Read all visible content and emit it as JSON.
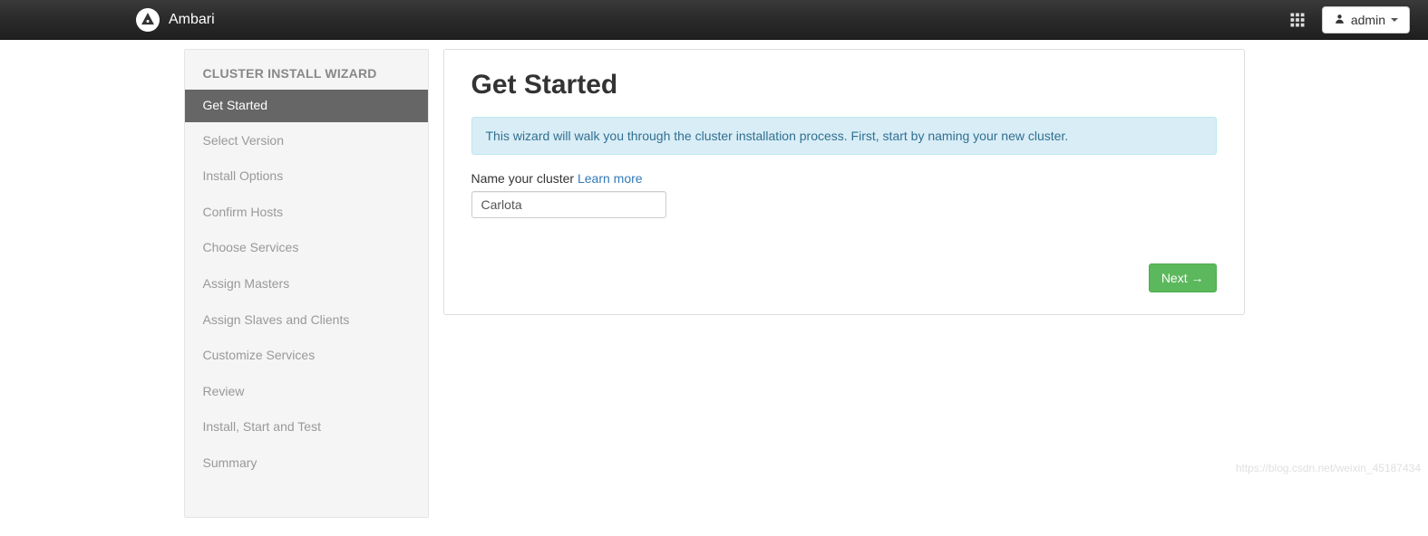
{
  "navbar": {
    "brand": "Ambari",
    "user_label": "admin"
  },
  "sidebar": {
    "title": "CLUSTER INSTALL WIZARD",
    "active_index": 0,
    "steps": [
      {
        "label": "Get Started"
      },
      {
        "label": "Select Version"
      },
      {
        "label": "Install Options"
      },
      {
        "label": "Confirm Hosts"
      },
      {
        "label": "Choose Services"
      },
      {
        "label": "Assign Masters"
      },
      {
        "label": "Assign Slaves and Clients"
      },
      {
        "label": "Customize Services"
      },
      {
        "label": "Review"
      },
      {
        "label": "Install, Start and Test"
      },
      {
        "label": "Summary"
      }
    ]
  },
  "main": {
    "title": "Get Started",
    "info_text": "This wizard will walk you through the cluster installation process. First, start by naming your new cluster.",
    "cluster_name": {
      "label": "Name your cluster",
      "learn_more": "Learn more",
      "value": "Carlota"
    },
    "next_label": "Next →"
  },
  "watermark": "https://blog.csdn.net/weixin_45187434"
}
